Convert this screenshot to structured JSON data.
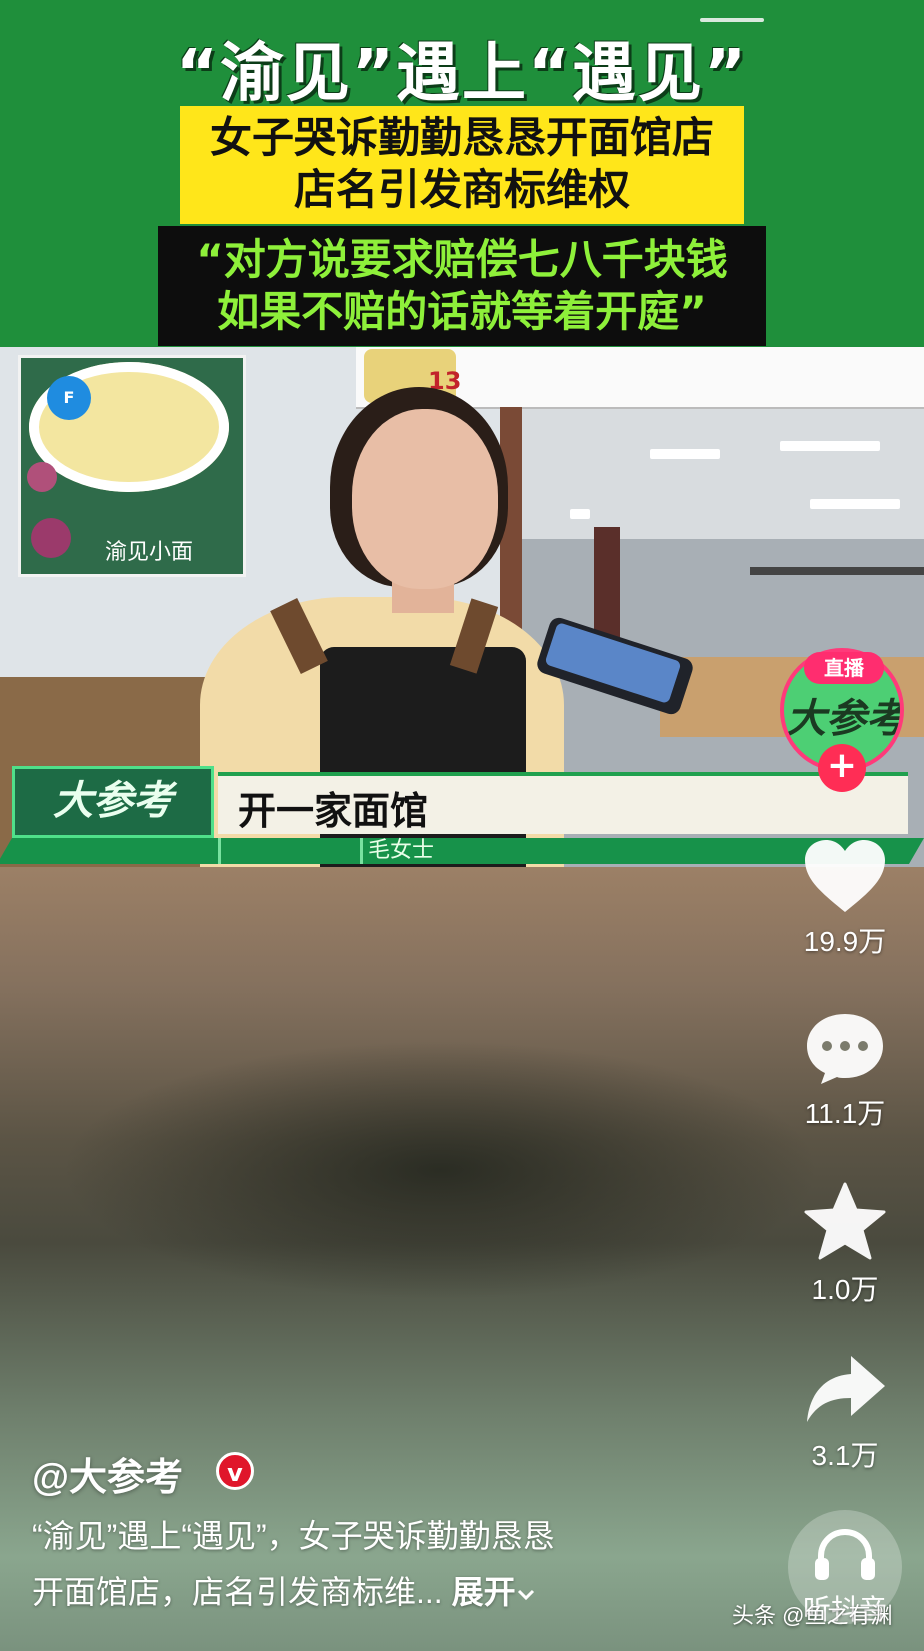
{
  "headline": {
    "title": "“渝见”遇上“遇见”",
    "yellow_lines": [
      "女子哭诉勤勤恳恳开面馆店",
      "店名引发商标维权"
    ],
    "quote_lines": [
      "“对方说要求赔偿七八千块钱",
      "如果不赔的话就等着开庭”"
    ]
  },
  "scene": {
    "poster_badge": "F",
    "poster_logo_text": "渝见小面",
    "menu_price": "13"
  },
  "lower_third": {
    "logo_text": "大参考",
    "caption": "开一家面馆",
    "speaker": "毛女士"
  },
  "live": {
    "tag": "直播",
    "avatar_text": "大参考",
    "follow_symbol": "+"
  },
  "actions": {
    "likes": "19.9万",
    "comments": "11.1万",
    "favorites": "1.0万",
    "shares": "3.1万",
    "listen_label": "听抖音"
  },
  "post": {
    "author": "@大参考",
    "verified_mark": "v",
    "description_line1": "“渝见”遇上“遇见”，女子哭诉勤勤恳恳",
    "description_line2": "开面馆店，店名引发商标维...",
    "expand_label": "展开",
    "watermark": "头条 @鱼之有渊"
  },
  "colors": {
    "banner_green": "#1f8f3b",
    "headline_yellow": "#ffe61a",
    "quote_green": "#8ef03a",
    "live_pink": "#ff2d6f"
  },
  "icons": [
    "heart-icon",
    "comment-icon",
    "star-icon",
    "share-icon",
    "headphones-icon",
    "chevron-down-icon"
  ]
}
